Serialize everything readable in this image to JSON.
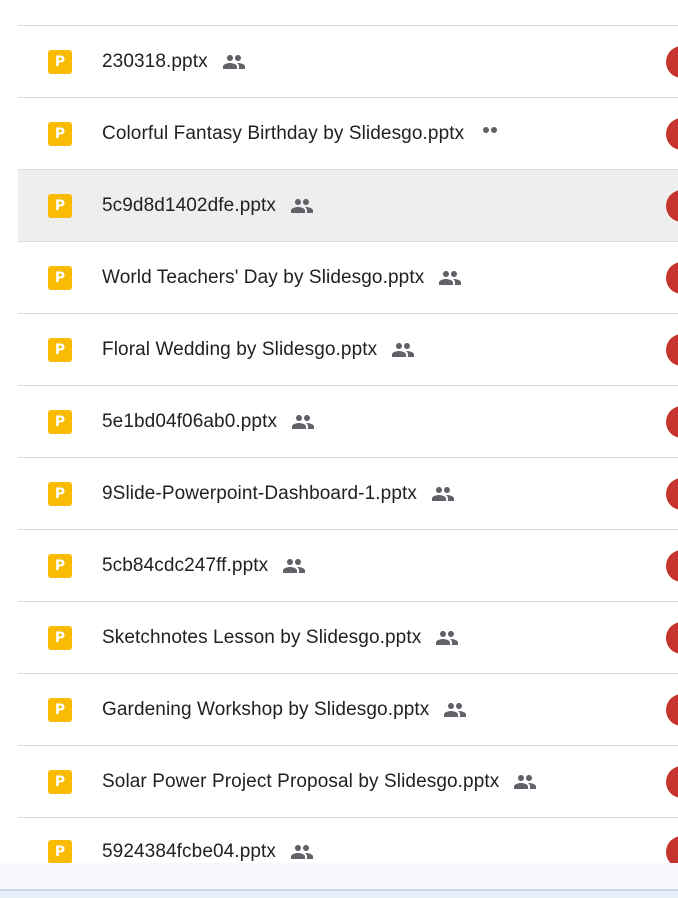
{
  "files": [
    {
      "name": "230318.pptx",
      "shared": true,
      "icon": "slides-icon",
      "icon_letter": "P"
    },
    {
      "name": "Colorful Fantasy Birthday by Slidesgo.pptx",
      "shared": true,
      "icon": "slides-icon",
      "icon_letter": "P"
    },
    {
      "name": "5c9d8d1402dfe.pptx",
      "shared": true,
      "icon": "slides-icon",
      "icon_letter": "P",
      "selected": true
    },
    {
      "name": "World Teachers' Day by Slidesgo.pptx",
      "shared": true,
      "icon": "slides-icon",
      "icon_letter": "P"
    },
    {
      "name": "Floral Wedding by Slidesgo.pptx",
      "shared": true,
      "icon": "slides-icon",
      "icon_letter": "P"
    },
    {
      "name": "5e1bd04f06ab0.pptx",
      "shared": true,
      "icon": "slides-icon",
      "icon_letter": "P"
    },
    {
      "name": "9Slide-Powerpoint-Dashboard-1.pptx",
      "shared": true,
      "icon": "slides-icon",
      "icon_letter": "P"
    },
    {
      "name": "5cb84cdc247ff.pptx",
      "shared": true,
      "icon": "slides-icon",
      "icon_letter": "P"
    },
    {
      "name": "Sketchnotes Lesson by Slidesgo.pptx",
      "shared": true,
      "icon": "slides-icon",
      "icon_letter": "P"
    },
    {
      "name": "Gardening Workshop by Slidesgo.pptx",
      "shared": true,
      "icon": "slides-icon",
      "icon_letter": "P"
    },
    {
      "name": "Solar Power Project Proposal by Slidesgo.pptx",
      "shared": true,
      "icon": "slides-icon",
      "icon_letter": "P"
    },
    {
      "name": "5924384fcbe04.pptx",
      "shared": true,
      "icon": "slides-icon",
      "icon_letter": "P"
    }
  ],
  "colors": {
    "slides_icon": "#f9bb04",
    "avatar": "#c5352d",
    "selected_row": "#eeeeee",
    "divider": "#dadce0",
    "text": "#202124",
    "shared_icon": "#5f6368"
  }
}
